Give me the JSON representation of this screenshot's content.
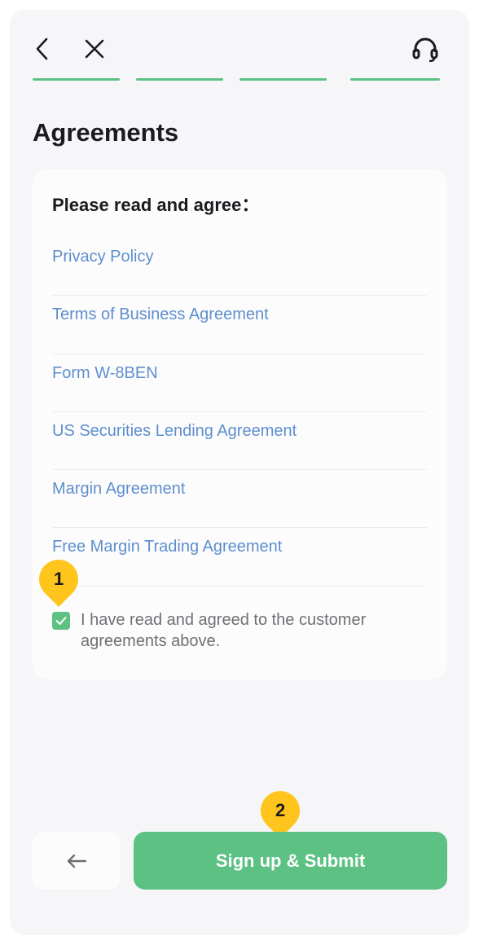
{
  "header": {
    "back_icon": "chevron-left-icon",
    "close_icon": "close-icon",
    "support_icon": "headset-icon",
    "progress_steps_total": 4,
    "progress_steps_completed": 4
  },
  "page_title": "Agreements",
  "card": {
    "heading": "Please read and agree：",
    "agreements": [
      "Privacy Policy",
      "Terms of Business Agreement",
      "Form W-8BEN",
      "US Securities Lending Agreement",
      "Margin Agreement",
      "Free Margin Trading Agreement"
    ],
    "consent_checked": true,
    "consent_text": "I have read and agreed to the customer agreements above."
  },
  "markers": {
    "first": "1",
    "second": "2"
  },
  "footer": {
    "prev_icon": "arrow-left-icon",
    "submit_label": "Sign up & Submit"
  },
  "colors": {
    "accent": "#5cc183",
    "link": "#5d8fcd",
    "marker": "#ffc51d",
    "background": "#f6f6f9"
  }
}
